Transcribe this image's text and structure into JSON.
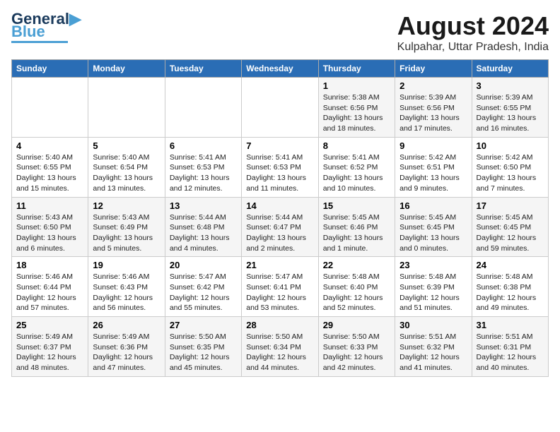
{
  "header": {
    "logo_line1": "General",
    "logo_line2": "Blue",
    "main_title": "August 2024",
    "subtitle": "Kulpahar, Uttar Pradesh, India"
  },
  "weekdays": [
    "Sunday",
    "Monday",
    "Tuesday",
    "Wednesday",
    "Thursday",
    "Friday",
    "Saturday"
  ],
  "weeks": [
    [
      {
        "day": "",
        "info": ""
      },
      {
        "day": "",
        "info": ""
      },
      {
        "day": "",
        "info": ""
      },
      {
        "day": "",
        "info": ""
      },
      {
        "day": "1",
        "info": "Sunrise: 5:38 AM\nSunset: 6:56 PM\nDaylight: 13 hours\nand 18 minutes."
      },
      {
        "day": "2",
        "info": "Sunrise: 5:39 AM\nSunset: 6:56 PM\nDaylight: 13 hours\nand 17 minutes."
      },
      {
        "day": "3",
        "info": "Sunrise: 5:39 AM\nSunset: 6:55 PM\nDaylight: 13 hours\nand 16 minutes."
      }
    ],
    [
      {
        "day": "4",
        "info": "Sunrise: 5:40 AM\nSunset: 6:55 PM\nDaylight: 13 hours\nand 15 minutes."
      },
      {
        "day": "5",
        "info": "Sunrise: 5:40 AM\nSunset: 6:54 PM\nDaylight: 13 hours\nand 13 minutes."
      },
      {
        "day": "6",
        "info": "Sunrise: 5:41 AM\nSunset: 6:53 PM\nDaylight: 13 hours\nand 12 minutes."
      },
      {
        "day": "7",
        "info": "Sunrise: 5:41 AM\nSunset: 6:53 PM\nDaylight: 13 hours\nand 11 minutes."
      },
      {
        "day": "8",
        "info": "Sunrise: 5:41 AM\nSunset: 6:52 PM\nDaylight: 13 hours\nand 10 minutes."
      },
      {
        "day": "9",
        "info": "Sunrise: 5:42 AM\nSunset: 6:51 PM\nDaylight: 13 hours\nand 9 minutes."
      },
      {
        "day": "10",
        "info": "Sunrise: 5:42 AM\nSunset: 6:50 PM\nDaylight: 13 hours\nand 7 minutes."
      }
    ],
    [
      {
        "day": "11",
        "info": "Sunrise: 5:43 AM\nSunset: 6:50 PM\nDaylight: 13 hours\nand 6 minutes."
      },
      {
        "day": "12",
        "info": "Sunrise: 5:43 AM\nSunset: 6:49 PM\nDaylight: 13 hours\nand 5 minutes."
      },
      {
        "day": "13",
        "info": "Sunrise: 5:44 AM\nSunset: 6:48 PM\nDaylight: 13 hours\nand 4 minutes."
      },
      {
        "day": "14",
        "info": "Sunrise: 5:44 AM\nSunset: 6:47 PM\nDaylight: 13 hours\nand 2 minutes."
      },
      {
        "day": "15",
        "info": "Sunrise: 5:45 AM\nSunset: 6:46 PM\nDaylight: 13 hours\nand 1 minute."
      },
      {
        "day": "16",
        "info": "Sunrise: 5:45 AM\nSunset: 6:45 PM\nDaylight: 13 hours\nand 0 minutes."
      },
      {
        "day": "17",
        "info": "Sunrise: 5:45 AM\nSunset: 6:45 PM\nDaylight: 12 hours\nand 59 minutes."
      }
    ],
    [
      {
        "day": "18",
        "info": "Sunrise: 5:46 AM\nSunset: 6:44 PM\nDaylight: 12 hours\nand 57 minutes."
      },
      {
        "day": "19",
        "info": "Sunrise: 5:46 AM\nSunset: 6:43 PM\nDaylight: 12 hours\nand 56 minutes."
      },
      {
        "day": "20",
        "info": "Sunrise: 5:47 AM\nSunset: 6:42 PM\nDaylight: 12 hours\nand 55 minutes."
      },
      {
        "day": "21",
        "info": "Sunrise: 5:47 AM\nSunset: 6:41 PM\nDaylight: 12 hours\nand 53 minutes."
      },
      {
        "day": "22",
        "info": "Sunrise: 5:48 AM\nSunset: 6:40 PM\nDaylight: 12 hours\nand 52 minutes."
      },
      {
        "day": "23",
        "info": "Sunrise: 5:48 AM\nSunset: 6:39 PM\nDaylight: 12 hours\nand 51 minutes."
      },
      {
        "day": "24",
        "info": "Sunrise: 5:48 AM\nSunset: 6:38 PM\nDaylight: 12 hours\nand 49 minutes."
      }
    ],
    [
      {
        "day": "25",
        "info": "Sunrise: 5:49 AM\nSunset: 6:37 PM\nDaylight: 12 hours\nand 48 minutes."
      },
      {
        "day": "26",
        "info": "Sunrise: 5:49 AM\nSunset: 6:36 PM\nDaylight: 12 hours\nand 47 minutes."
      },
      {
        "day": "27",
        "info": "Sunrise: 5:50 AM\nSunset: 6:35 PM\nDaylight: 12 hours\nand 45 minutes."
      },
      {
        "day": "28",
        "info": "Sunrise: 5:50 AM\nSunset: 6:34 PM\nDaylight: 12 hours\nand 44 minutes."
      },
      {
        "day": "29",
        "info": "Sunrise: 5:50 AM\nSunset: 6:33 PM\nDaylight: 12 hours\nand 42 minutes."
      },
      {
        "day": "30",
        "info": "Sunrise: 5:51 AM\nSunset: 6:32 PM\nDaylight: 12 hours\nand 41 minutes."
      },
      {
        "day": "31",
        "info": "Sunrise: 5:51 AM\nSunset: 6:31 PM\nDaylight: 12 hours\nand 40 minutes."
      }
    ]
  ]
}
